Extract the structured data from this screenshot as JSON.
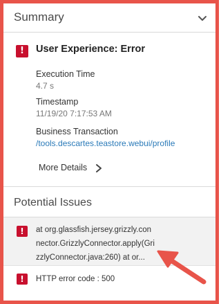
{
  "summary": {
    "title": "Summary",
    "toggle_icon": "chevron-down-icon"
  },
  "experience": {
    "status_icon": "error-badge-icon",
    "title": "User Experience: Error",
    "fields": [
      {
        "label": "Execution Time",
        "value": "4.7 s"
      },
      {
        "label": "Timestamp",
        "value": "11/19/20 7:17:53 AM"
      },
      {
        "label": "Business Transaction",
        "value": "/tools.descartes.teastore.webui/profile"
      }
    ],
    "more_details_label": "More Details",
    "more_details_icon": "chevron-right-icon"
  },
  "issues": {
    "title": "Potential Issues",
    "items": [
      {
        "icon": "error-badge-icon",
        "lines": [
          "at org.glassfish.jersey.grizzly.con",
          "nector.GrizzlyConnector.apply(Gri",
          "zzlyConnector.java:260) at or..."
        ]
      },
      {
        "icon": "error-badge-icon",
        "lines": [
          "HTTP error code : 500"
        ]
      }
    ]
  },
  "colors": {
    "frame": "#e8544a",
    "error": "#c8102e",
    "link": "#2a7ab8",
    "annotation_arrow": "#e8544a"
  }
}
